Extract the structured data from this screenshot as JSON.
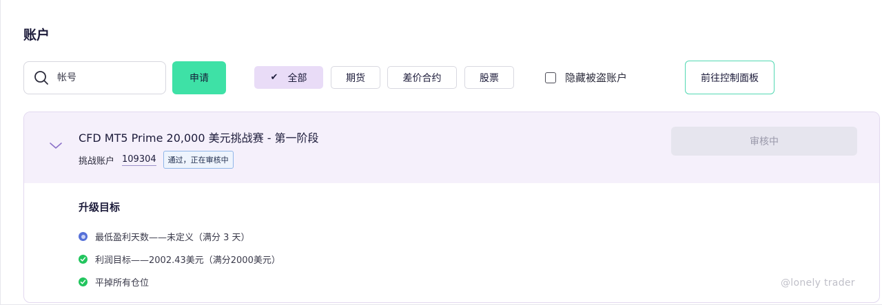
{
  "page": {
    "title": "账户"
  },
  "search": {
    "placeholder": "帐号"
  },
  "apply_button": {
    "label": "申请"
  },
  "filters": [
    {
      "label": "全部",
      "active": true
    },
    {
      "label": "期货",
      "active": false
    },
    {
      "label": "差价合约",
      "active": false
    },
    {
      "label": "股票",
      "active": false
    }
  ],
  "hide_stolen": {
    "label": "隐藏被盗账户",
    "checked": false
  },
  "dashboard_button": {
    "label": "前往控制面板"
  },
  "account": {
    "title": "CFD MT5 Prime 20,000 美元挑战赛 - 第一阶段",
    "type_label": "挑战账户",
    "number": "109304",
    "status_badge": "通过，正在审核中",
    "review_button": "审核中"
  },
  "goals": {
    "title": "升级目标",
    "items": [
      {
        "text": "最低盈利天数——未定义（满分 3 天）",
        "status": "pending"
      },
      {
        "text": "利润目标——2002.43美元（满分2000美元）",
        "status": "done"
      },
      {
        "text": "平掉所有仓位",
        "status": "done"
      }
    ]
  },
  "watermark": {
    "text": "@lonely trader"
  },
  "colors": {
    "accent_green": "#3ee1a6",
    "active_filter": "#e9dcf7",
    "card_header": "#f5f0fb",
    "success": "#22c55e",
    "pending": "#5570d8"
  }
}
